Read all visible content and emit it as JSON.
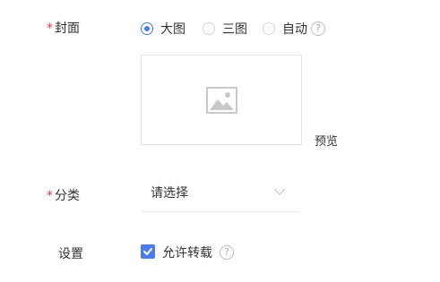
{
  "form": {
    "cover": {
      "label": "封面",
      "required_mark": "*",
      "options": [
        {
          "label": "大图",
          "checked": true
        },
        {
          "label": "三图",
          "checked": false
        },
        {
          "label": "自动",
          "checked": false
        }
      ],
      "help_glyph": "?",
      "preview_label": "预览",
      "placeholder_icon": "image-placeholder-icon"
    },
    "category": {
      "label": "分类",
      "required_mark": "*",
      "select_placeholder": "请选择",
      "arrow_icon": "chevron-down-icon"
    },
    "settings": {
      "label": "设置",
      "checkbox_label": "允许转载",
      "checkbox_checked": true,
      "help_glyph": "?"
    }
  },
  "colors": {
    "accent": "#4a7cf0",
    "required": "#e5393e",
    "text": "#333333",
    "border": "#e3e3e3",
    "placeholder_icon": "#c9c9c9"
  }
}
